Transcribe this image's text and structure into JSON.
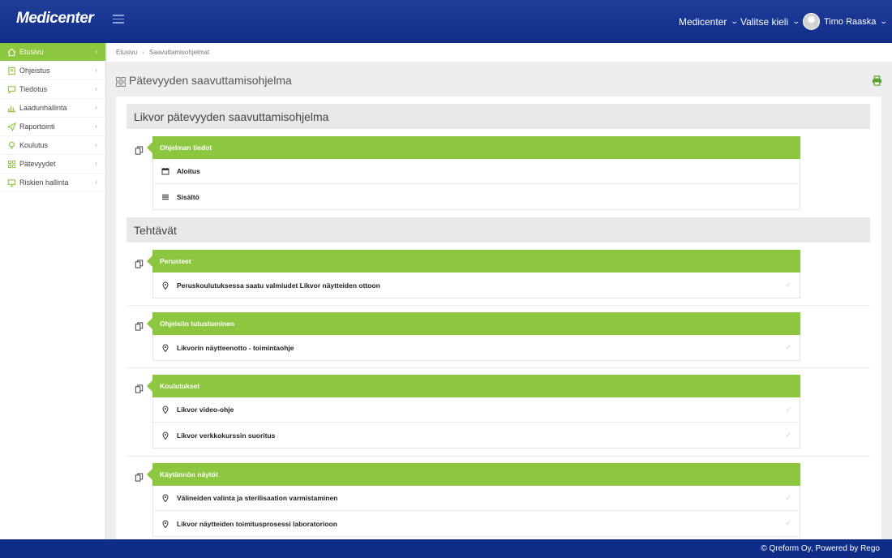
{
  "header": {
    "logo": "Medicenter",
    "org_menu": "Medicenter",
    "language_menu": "Valitse kieli",
    "user_name": "Timo Raaska"
  },
  "sidebar": {
    "items": [
      {
        "label": "Etusivu",
        "icon": "home-icon"
      },
      {
        "label": "Ohjeistus",
        "icon": "book-icon"
      },
      {
        "label": "Tiedotus",
        "icon": "message-icon"
      },
      {
        "label": "Laadunhallinta",
        "icon": "bar-chart-icon"
      },
      {
        "label": "Raportointi",
        "icon": "paper-plane-icon"
      },
      {
        "label": "Koulutus",
        "icon": "lightbulb-icon"
      },
      {
        "label": "Pätevyydet",
        "icon": "grid-icon"
      },
      {
        "label": "Riskien hallinta",
        "icon": "monitor-icon"
      }
    ],
    "active_index": 0
  },
  "breadcrumb": [
    "Etusivu",
    "Saavuttamisohjelmat"
  ],
  "page": {
    "title": "Pätevyyden saavuttamisohjelma",
    "program_title": "Likvor pätevyyden saavuttamisohjelma",
    "program_info": {
      "title": "Ohjelman tiedot",
      "rows": [
        {
          "label": "Aloitus",
          "icon": "calendar-icon"
        },
        {
          "label": "Sisältö",
          "icon": "list-icon"
        }
      ]
    },
    "tasks_title": "Tehtävät",
    "task_groups": [
      {
        "title": "Perusteet",
        "items": [
          "Peruskoulutuksessa saatu valmiudet Likvor näytteiden ottoon"
        ]
      },
      {
        "title": "Ohjeisiin tutustuminen",
        "items": [
          "Likvorin näytteenotto - toimintaohje"
        ]
      },
      {
        "title": "Koulutukset",
        "items": [
          "Likvor video-ohje",
          "Likvor verkkokurssin suoritus"
        ]
      },
      {
        "title": "Käytännön näytöt",
        "items": [
          "Välineiden valinta ja sterilisaation varmistaminen",
          "Likvor näytteiden toimitusprosessi laboratorioon"
        ]
      }
    ]
  },
  "footer": {
    "text": "© Qreform Oy, Powered by Rego"
  },
  "colors": {
    "header": "#14338f",
    "accent": "#8dc63f",
    "footer": "#0f2c88"
  }
}
